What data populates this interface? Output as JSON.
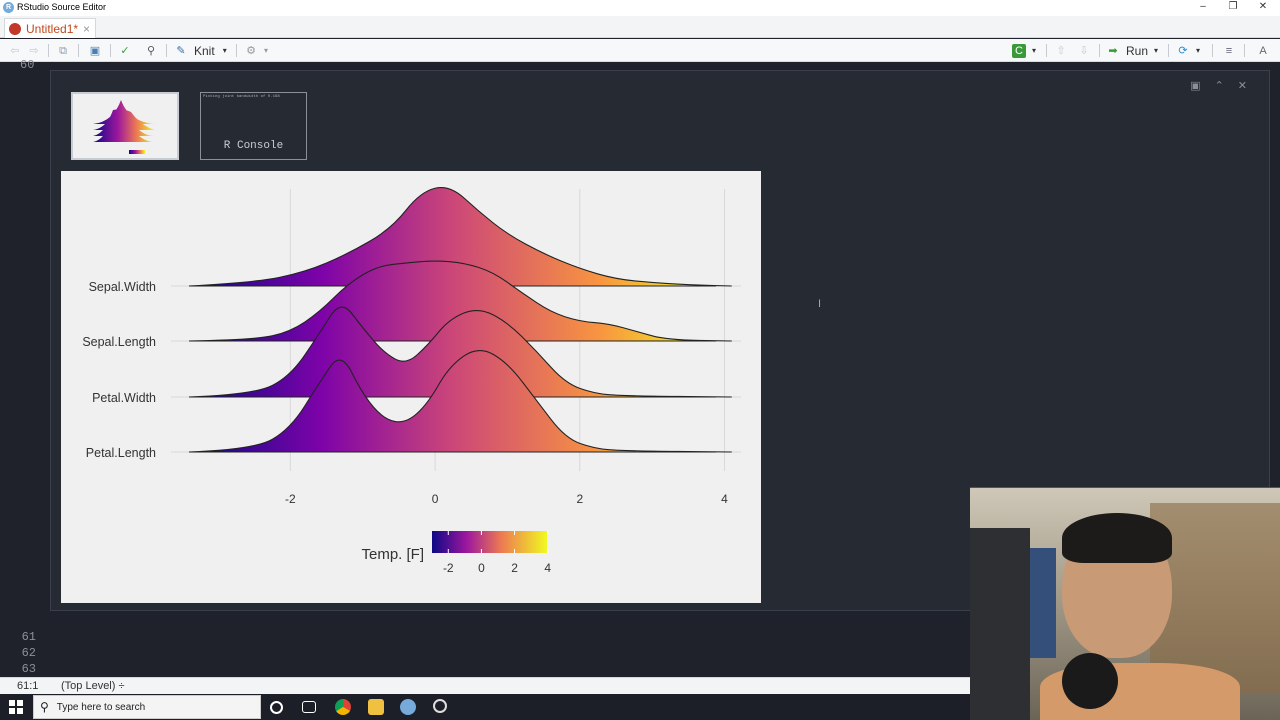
{
  "window": {
    "title": "RStudio Source Editor",
    "minimize": "–",
    "restore": "❐",
    "close": "✕"
  },
  "tab": {
    "label": "Untitled1*",
    "close": "×"
  },
  "toolbar": {
    "knit_label": "Knit",
    "run_label": "Run"
  },
  "chunk": {
    "console_thumb_label": "R Console",
    "console_thumb_text": "Picking joint bandwidth of 0.168",
    "controls": [
      "▣",
      "⌃",
      "✕"
    ]
  },
  "line_numbers": [
    "61",
    "62",
    "63"
  ],
  "top_line_fragment": "60",
  "status": {
    "position": "61:1",
    "scope": "(Top Level) ÷"
  },
  "taskbar": {
    "search_placeholder": "Type here to search"
  },
  "chart_data": {
    "type": "ridgeline",
    "categories": [
      "Petal.Length",
      "Petal.Width",
      "Sepal.Length",
      "Sepal.Width"
    ],
    "x_ticks": [
      "-2",
      "0",
      "2",
      "4"
    ],
    "xlim": [
      -3.4,
      4.2
    ],
    "fill_scale": {
      "name": "Temp. [F]",
      "ticks": [
        "-2",
        "0",
        "2",
        "4"
      ],
      "colors": [
        "#0d0887",
        "#7e03a8",
        "#cc4778",
        "#f89540",
        "#f0f921"
      ]
    },
    "series": [
      {
        "name": "Sepal.Width",
        "x": [
          -3.4,
          -2.5,
          -1.8,
          -1.2,
          -0.6,
          -0.2,
          0.2,
          0.6,
          1.0,
          1.5,
          2.0,
          2.5,
          3.0,
          3.5,
          4.1
        ],
        "density": [
          0,
          0.03,
          0.12,
          0.28,
          0.5,
          0.82,
          0.88,
          0.65,
          0.45,
          0.28,
          0.15,
          0.06,
          0.03,
          0.01,
          0
        ]
      },
      {
        "name": "Sepal.Length",
        "x": [
          -3.4,
          -2.5,
          -2.0,
          -1.6,
          -1.2,
          -0.8,
          -0.4,
          0,
          0.4,
          0.8,
          1.2,
          1.6,
          2.0,
          2.4,
          2.8,
          3.2,
          4.1
        ],
        "density": [
          0,
          0.01,
          0.08,
          0.25,
          0.5,
          0.65,
          0.68,
          0.7,
          0.68,
          0.6,
          0.42,
          0.25,
          0.17,
          0.15,
          0.08,
          0.01,
          0
        ]
      },
      {
        "name": "Petal.Width",
        "x": [
          -3.4,
          -2.5,
          -2.0,
          -1.6,
          -1.3,
          -1.0,
          -0.7,
          -0.4,
          -0.1,
          0.2,
          0.6,
          1.0,
          1.4,
          1.8,
          2.2,
          2.6,
          4.1
        ],
        "density": [
          0,
          0.02,
          0.18,
          0.55,
          0.85,
          0.6,
          0.38,
          0.28,
          0.45,
          0.68,
          0.78,
          0.65,
          0.4,
          0.12,
          0.03,
          0.01,
          0
        ]
      },
      {
        "name": "Petal.Length",
        "x": [
          -3.4,
          -2.5,
          -2.0,
          -1.6,
          -1.3,
          -1.0,
          -0.7,
          -0.4,
          -0.1,
          0.2,
          0.6,
          1.0,
          1.4,
          1.8,
          2.2,
          2.6,
          4.1
        ],
        "density": [
          0,
          0.02,
          0.2,
          0.6,
          0.88,
          0.5,
          0.28,
          0.25,
          0.42,
          0.75,
          0.92,
          0.78,
          0.45,
          0.12,
          0.03,
          0.01,
          0
        ]
      }
    ]
  }
}
